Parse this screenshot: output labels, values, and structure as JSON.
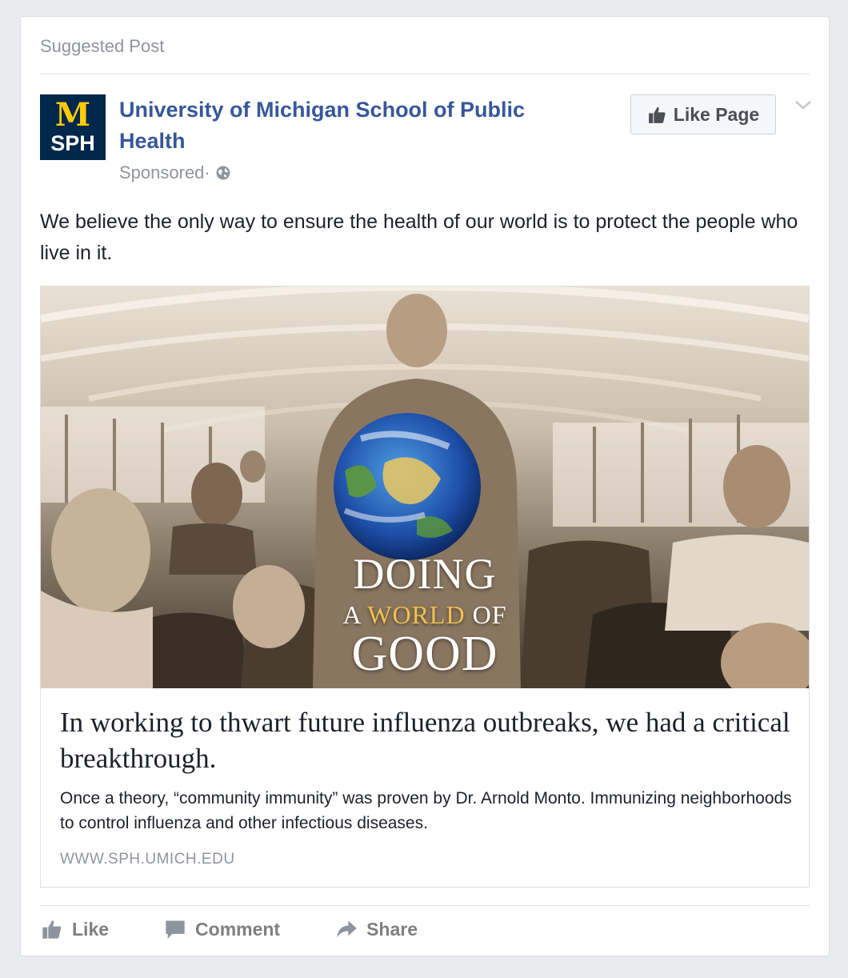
{
  "post": {
    "suggested_label": "Suggested Post",
    "page_name": "University of Michigan School of Public Health",
    "avatar": {
      "m": "M",
      "sph": "SPH"
    },
    "sponsored_label": "Sponsored",
    "separator": " · ",
    "like_page_label": "Like Page",
    "text": "We believe the only way to ensure the health of our world is to protect the people who live in it."
  },
  "media": {
    "tagline": {
      "line1": "DOING",
      "line2_a": "A ",
      "line2_b": "WORLD",
      "line2_c": " OF",
      "line3": "GOOD"
    },
    "headline": "In working to thwart future influenza outbreaks, we had a critical breakthrough.",
    "description": "Once a theory, “community immunity” was proven by Dr. Arnold Monto. Immunizing neighborhoods to control influenza and other infectious diseases.",
    "domain": "WWW.SPH.UMICH.EDU"
  },
  "actions": {
    "like": "Like",
    "comment": "Comment",
    "share": "Share"
  },
  "colors": {
    "link_blue": "#365899",
    "michigan_blue": "#00274c",
    "maize": "#ffcb05",
    "muted_gray": "#90949c"
  },
  "icons": [
    "thumbs-up-icon",
    "globe-icon",
    "chevron-down-icon",
    "comment-icon",
    "share-icon"
  ]
}
